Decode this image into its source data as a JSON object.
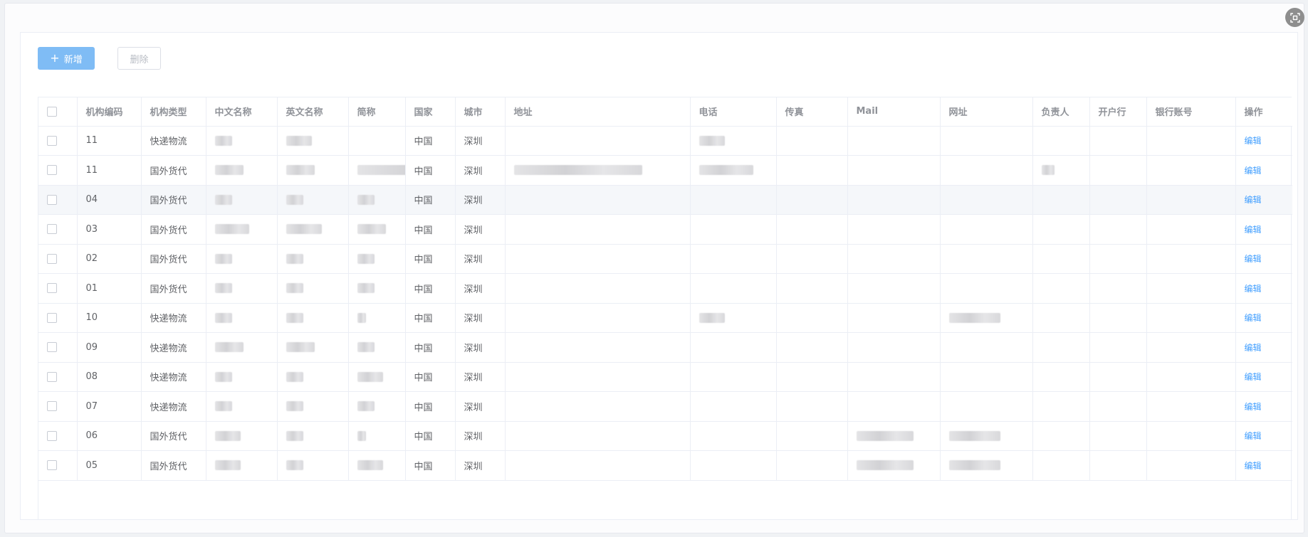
{
  "toolbar": {
    "add_label": "新增",
    "delete_label": "删除"
  },
  "table": {
    "columns": [
      "机构编码",
      "机构类型",
      "中文名称",
      "英文名称",
      "简称",
      "国家",
      "城市",
      "地址",
      "电话",
      "传真",
      "Mail",
      "网址",
      "负责人",
      "开户行",
      "银行账号",
      "操作"
    ],
    "rows": [
      {
        "code": "11",
        "type": "快递物流",
        "country": "中国",
        "city": "深圳",
        "action": "编辑"
      },
      {
        "code": "11",
        "type": "国外货代",
        "country": "中国",
        "city": "深圳",
        "action": "编辑"
      },
      {
        "code": "04",
        "type": "国外货代",
        "country": "中国",
        "city": "深圳",
        "action": "编辑"
      },
      {
        "code": "03",
        "type": "国外货代",
        "country": "中国",
        "city": "深圳",
        "action": "编辑"
      },
      {
        "code": "02",
        "type": "国外货代",
        "country": "中国",
        "city": "深圳",
        "action": "编辑"
      },
      {
        "code": "01",
        "type": "国外货代",
        "country": "中国",
        "city": "深圳",
        "action": "编辑"
      },
      {
        "code": "10",
        "type": "快递物流",
        "country": "中国",
        "city": "深圳",
        "action": "编辑"
      },
      {
        "code": "09",
        "type": "快递物流",
        "country": "中国",
        "city": "深圳",
        "action": "编辑"
      },
      {
        "code": "08",
        "type": "快递物流",
        "country": "中国",
        "city": "深圳",
        "action": "编辑"
      },
      {
        "code": "07",
        "type": "快递物流",
        "country": "中国",
        "city": "深圳",
        "action": "编辑"
      },
      {
        "code": "06",
        "type": "国外货代",
        "country": "中国",
        "city": "深圳",
        "action": "编辑"
      },
      {
        "code": "05",
        "type": "国外货代",
        "country": "中国",
        "city": "深圳",
        "action": "编辑"
      }
    ]
  },
  "colors": {
    "primary": "#7fbcf5",
    "link": "#409eff",
    "border": "#ebeef5"
  },
  "icons": {
    "corner": "screen-capture-icon",
    "add": "plus-icon"
  }
}
